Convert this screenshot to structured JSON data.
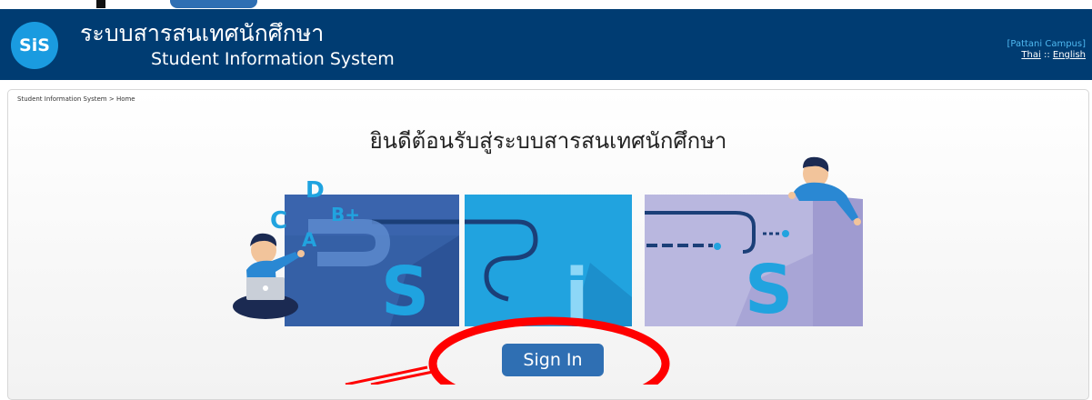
{
  "header": {
    "logo_text": "SiS",
    "title_thai": "ระบบสารสนเทศนักศึกษา",
    "title_english": "Student Information System",
    "campus": "[Pattani Campus]",
    "lang_thai": "Thai",
    "lang_separator": " :: ",
    "lang_english": "English"
  },
  "breadcrumb": "Student Information System > Home",
  "welcome": "ยินดีต้อนรับสู่ระบบสารสนเทศนักศึกษา",
  "illustration": {
    "grade_letters": [
      "D",
      "B+",
      "C",
      "A"
    ],
    "letters": [
      "S",
      "i",
      "S"
    ]
  },
  "signin_label": "Sign In",
  "colors": {
    "header_bg": "#003c72",
    "accent": "#2f6fb3",
    "annotation": "#ff0000"
  }
}
